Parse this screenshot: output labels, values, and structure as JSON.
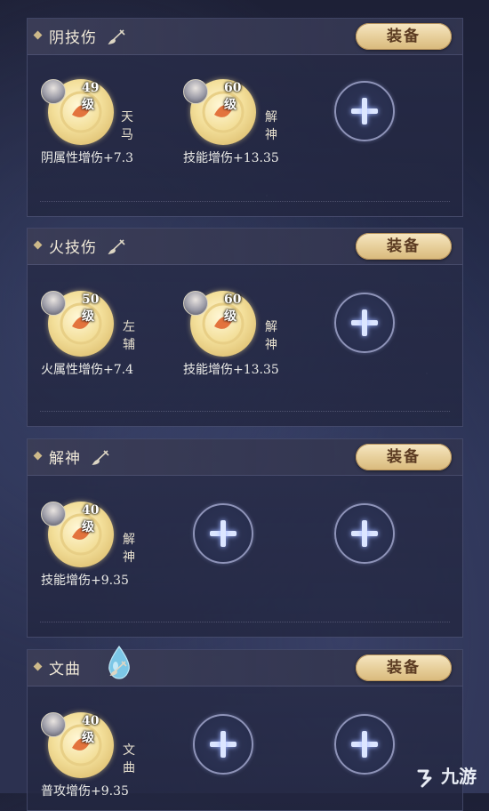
{
  "sections": [
    {
      "title": "阴技伤",
      "equip_label": "装备",
      "slots": [
        {
          "level": "49级",
          "star": "天马",
          "effect": "阴属性增伤+7.3"
        },
        {
          "level": "60级",
          "star": "解神",
          "effect": "技能增伤+13.35"
        }
      ]
    },
    {
      "title": "火技伤",
      "equip_label": "装备",
      "slots": [
        {
          "level": "50级",
          "star": "左辅",
          "effect": "火属性增伤+7.4"
        },
        {
          "level": "60级",
          "star": "解神",
          "effect": "技能增伤+13.35"
        }
      ]
    },
    {
      "title": "解神",
      "equip_label": "装备",
      "slots": [
        {
          "level": "40级",
          "star": "解神",
          "effect": "技能增伤+9.35"
        }
      ]
    },
    {
      "title": "文曲",
      "equip_label": "装备",
      "slots": [
        {
          "level": "40级",
          "star": "文曲",
          "effect": "普攻增伤+9.35"
        }
      ]
    }
  ],
  "icons": {
    "add_slot": "plus-icon",
    "edit": "brush-icon",
    "badge": "water-drop-icon"
  },
  "colors": {
    "equip_button": "#e8d09c",
    "coin": "#f3df9a",
    "background": "#232a48"
  },
  "watermark": "九游"
}
